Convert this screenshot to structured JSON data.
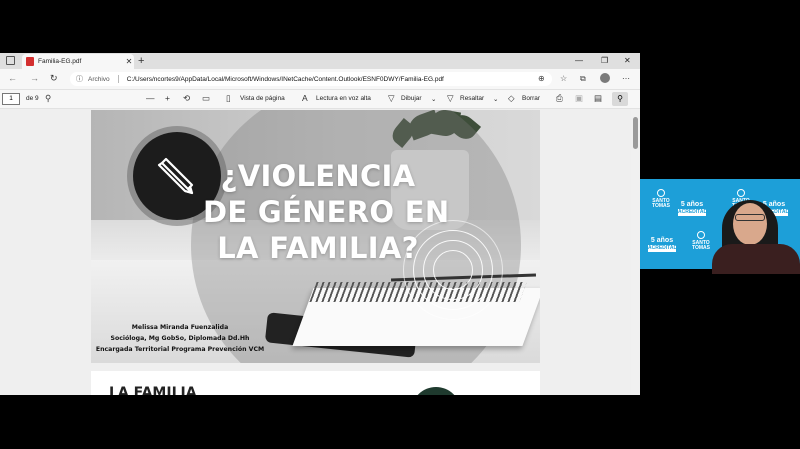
{
  "browser": {
    "tab_title": "Familia-EG.pdf",
    "tab_close": "✕",
    "new_tab": "+",
    "window_controls": [
      "—",
      "❐",
      "✕"
    ],
    "address": {
      "label": "Archivo",
      "url": "C:/Users/ncortes9/AppData/Local/Microsoft/Windows/INetCache/Content.Outlook/ESNF0DWY/Familia-EG.pdf"
    }
  },
  "pdf_toolbar": {
    "page_current": "1",
    "page_total": "de 9",
    "zoom_out": "—",
    "zoom_in": "+",
    "page_view": "Vista de página",
    "read_aloud": "Lectura en voz alta",
    "draw": "Dibujar",
    "highlight": "Resaltar",
    "erase": "Borrar"
  },
  "slide": {
    "title_lines": [
      "¿VIOLENCIA",
      "DE GÉNERO EN",
      "LA FAMILIA?"
    ],
    "author_lines": [
      "Melissa Miranda Fuenzalida",
      "Socióloga, Mg GobSo, Diplomada Dd.Hh",
      "Encargada Territorial Programa Prevención VCM"
    ]
  },
  "page2": {
    "title": "LA FAMILIA"
  },
  "video": {
    "logos": [
      {
        "name": "SANTO TOMAS",
        "year": "5 años",
        "sub": "ACREDITADA"
      },
      {
        "name": "SANTO TOMAS",
        "year": "5 años",
        "sub": "ACREDITADA"
      },
      {
        "name": "SANTO TOMAS",
        "year": "5 años",
        "sub": "ACREDITADA"
      }
    ]
  },
  "colors": {
    "video_bg": "#1d9fd8",
    "pdf_icon": "#d32f2f"
  }
}
